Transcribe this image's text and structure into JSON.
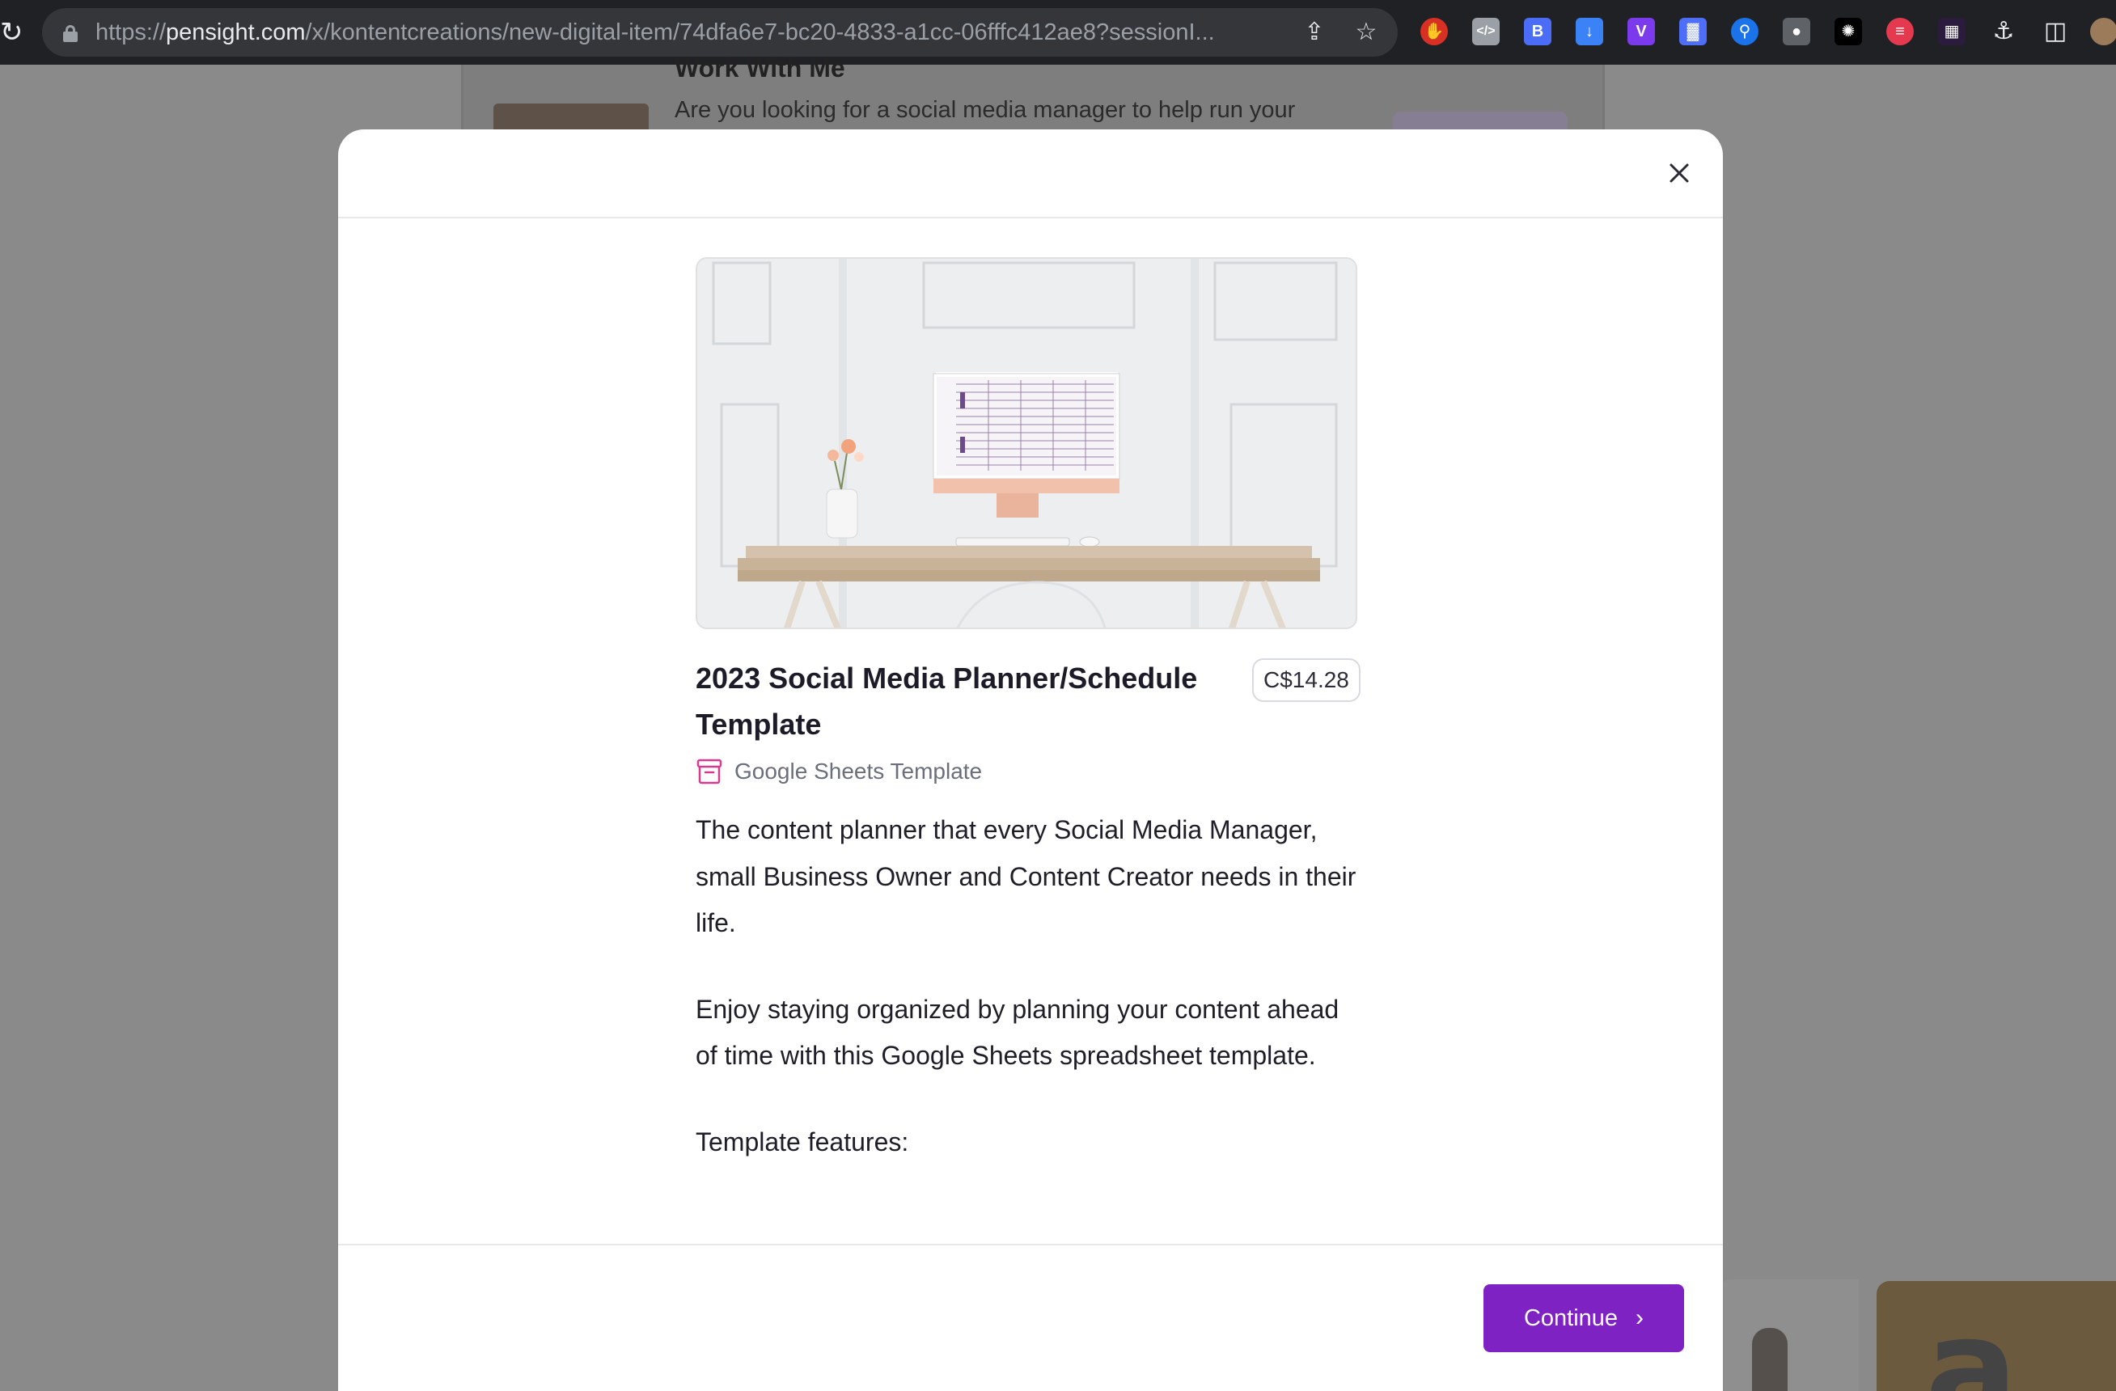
{
  "browser": {
    "url_prefix": "https://",
    "url_domain": "pensight.com",
    "url_path": "/x/kontentcreations/new-digital-item/74dfa6e7-bc20-4833-a1cc-06fffc412ae8?sessionI..."
  },
  "background": {
    "heading": "Work With Me",
    "text": "Are you looking for a social media manager to help run your"
  },
  "product": {
    "title": "2023 Social Media Planner/Schedule Template",
    "price": "C$14.28",
    "type_label": "Google Sheets Template",
    "description": [
      "The content planner that every Social Media Manager, small Business Owner and Content Creator needs in their life.",
      "Enjoy staying organized by planning your content ahead of time with this Google Sheets spreadsheet template.",
      "Template features:"
    ]
  },
  "footer": {
    "continue_label": "Continue"
  },
  "colors": {
    "accent": "#7f22c4",
    "type_icon": "#d63b8f",
    "chrome_bg": "#202124"
  },
  "icons": {
    "close": "close-icon",
    "type": "archive-box-icon",
    "continue": "chevron-right-icon"
  }
}
